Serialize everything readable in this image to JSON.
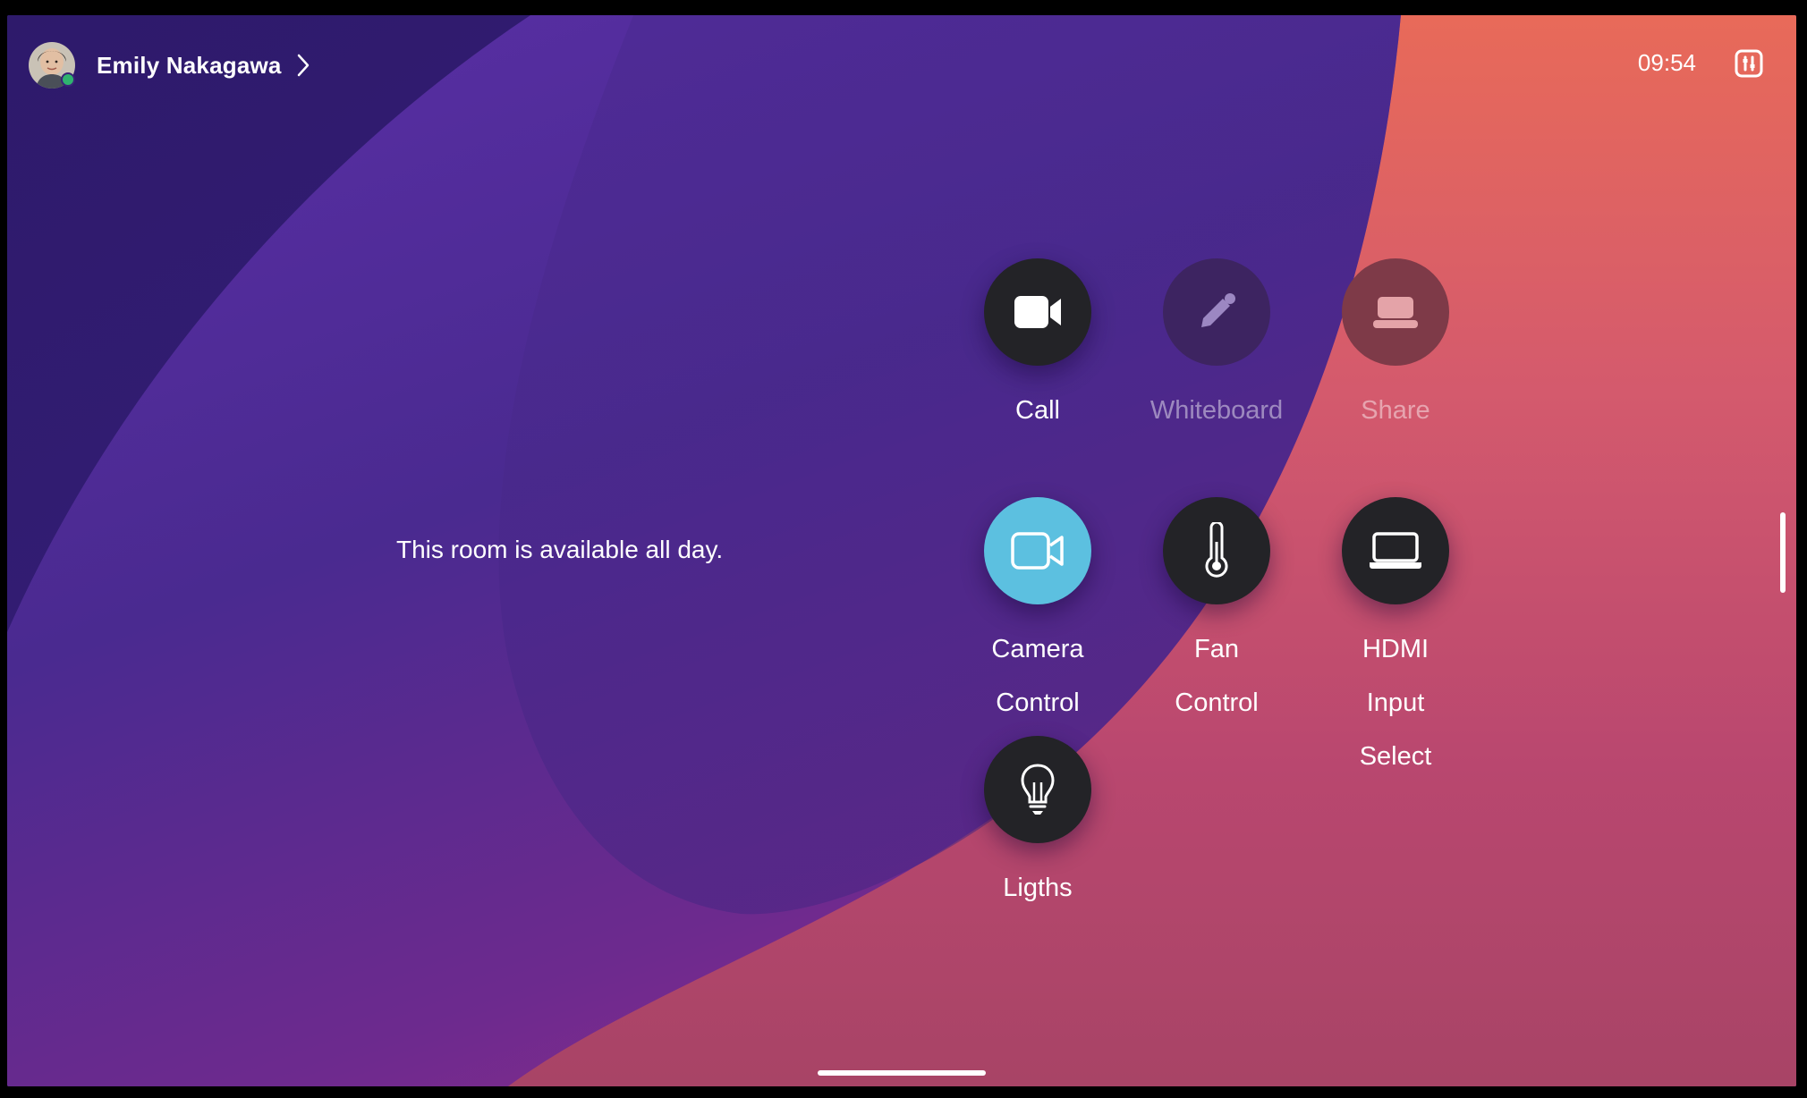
{
  "user": {
    "name": "Emily Nakagawa",
    "presence": "available",
    "avatar_icon": "user-avatar-photo"
  },
  "status_bar": {
    "time": "09:54",
    "panel_icon": "control-panel-icon"
  },
  "room_status": "This room is available all day.",
  "tiles": [
    {
      "id": "call",
      "label": "Call",
      "icon": "video-camera-filled-icon",
      "style": "dark",
      "enabled": true
    },
    {
      "id": "whiteboard",
      "label": "Whiteboard",
      "icon": "pencil-icon",
      "style": "dim-purple",
      "enabled": false
    },
    {
      "id": "share",
      "label": "Share",
      "icon": "share-screen-icon",
      "style": "dim-red",
      "enabled": false
    },
    {
      "id": "camera-control",
      "label": "Camera\nControl",
      "icon": "video-camera-outline-icon",
      "style": "blue",
      "enabled": true
    },
    {
      "id": "fan-control",
      "label": "Fan\nControl",
      "icon": "thermometer-icon",
      "style": "dark",
      "enabled": true
    },
    {
      "id": "hdmi-input-select",
      "label": "HDMI\nInput\nSelect",
      "icon": "laptop-icon",
      "style": "dark",
      "enabled": true
    },
    {
      "id": "lights",
      "label": "Ligths",
      "icon": "lightbulb-icon",
      "style": "dark",
      "enabled": true
    }
  ],
  "colors": {
    "accent_blue": "#5cc0e0",
    "tile_dark": "#232327",
    "presence_green": "#2fb36f"
  }
}
